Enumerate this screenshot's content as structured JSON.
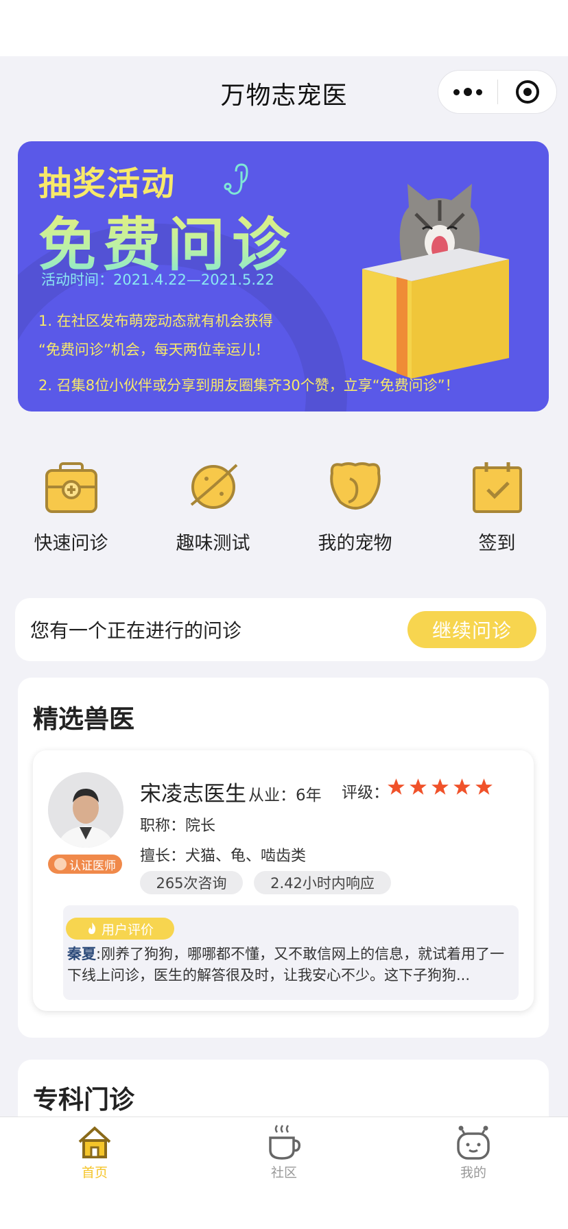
{
  "nav": {
    "title": "万物志宠医"
  },
  "banner": {
    "subtitle": "抽奖活动",
    "main": "免费问诊",
    "time": "活动时间：2021.4.22—2021.5.22",
    "rule1": "1. 在社区发布萌宠动态就有机会获得",
    "rule1b": "“免费问诊”机会，每天两位幸运儿！",
    "rule2": "2. 召集8位小伙伴或分享到朋友圈集齐30个赞，立享“免费问诊”！"
  },
  "quick": [
    {
      "label": "快速问诊",
      "icon": "medical-kit-icon"
    },
    {
      "label": "趣味测试",
      "icon": "planet-icon"
    },
    {
      "label": "我的宠物",
      "icon": "pet-face-icon"
    },
    {
      "label": "签到",
      "icon": "calendar-check-icon"
    }
  ],
  "pending": {
    "text": "您有一个正在进行的问诊",
    "button": "继续问诊"
  },
  "vets": {
    "title": "精选兽医",
    "doctor": {
      "name": "宋凌志医生",
      "experience": "从业：6年",
      "rating_label": "评级：",
      "rating": 5,
      "title": "职称：院长",
      "specialty": "擅长：犬猫、龟、啮齿类",
      "consults": "265次咨询",
      "response": "2.42小时内响应",
      "cert": "认证医师",
      "review_badge": "用户评价",
      "review_user": "秦夏",
      "review_text": ":刚养了狗狗，哪哪都不懂，又不敢信网上的信息，就试着用了一下线上问诊，医生的解答很及时，让我安心不少。这下子狗狗..."
    }
  },
  "special": {
    "title": "专科门诊"
  },
  "tabs": [
    {
      "label": "首页",
      "icon": "home-icon",
      "active": true
    },
    {
      "label": "社区",
      "icon": "coffee-cup-icon",
      "active": false
    },
    {
      "label": "我的",
      "icon": "robot-face-icon",
      "active": false
    }
  ],
  "colors": {
    "accent": "#f7d54f",
    "banner": "#5a59e8",
    "star": "#f0522a"
  }
}
